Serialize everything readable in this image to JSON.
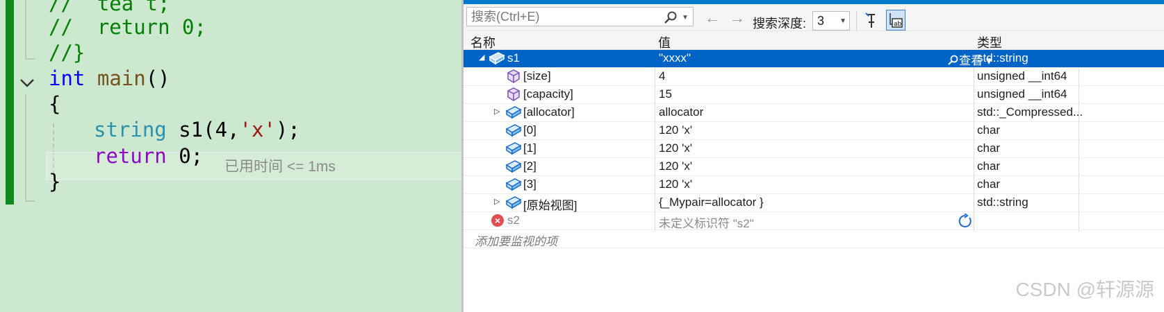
{
  "editor": {
    "lines": {
      "l0": "//  tea t;",
      "l1": "//  return 0;",
      "l2": "//}",
      "l3_kw": "int",
      "l3_fn": "main",
      "l3_rest": "()",
      "l4": "{",
      "l5_type": "string",
      "l5_name": " s1(4,",
      "l5_str": "'x'",
      "l5_rest": ");",
      "l6_ctl": "return",
      "l6_rest": " 0;",
      "l7": "}"
    },
    "perf_tip": "已用时间 <= 1ms"
  },
  "toolbar": {
    "search_placeholder": "搜索(Ctrl+E)",
    "depth_label": "搜索深度:",
    "depth_value": "3"
  },
  "grid": {
    "headers": {
      "name": "名称",
      "value": "值",
      "type": "类型"
    },
    "rows": [
      {
        "name": "s1",
        "value": "\"xxxx\"",
        "type": "std::string",
        "view_label": "查看"
      },
      {
        "name": "[size]",
        "value": "4",
        "type": "unsigned __int64"
      },
      {
        "name": "[capacity]",
        "value": "15",
        "type": "unsigned __int64"
      },
      {
        "name": "[allocator]",
        "value": "allocator",
        "type": "std::_Compressed..."
      },
      {
        "name": "[0]",
        "value": "120 'x'",
        "type": "char"
      },
      {
        "name": "[1]",
        "value": "120 'x'",
        "type": "char"
      },
      {
        "name": "[2]",
        "value": "120 'x'",
        "type": "char"
      },
      {
        "name": "[3]",
        "value": "120 'x'",
        "type": "char"
      },
      {
        "name": "[原始视图]",
        "value": "{_Mypair=allocator }",
        "type": "std::string"
      },
      {
        "name": "s2",
        "value": "未定义标识符 \"s2\"",
        "type": ""
      }
    ],
    "add_watch_text": "添加要监视的项"
  },
  "watermark": "CSDN @轩源源",
  "colors": {
    "selection": "#0063c6",
    "accent": "#007acc",
    "editor_bg": "#cce8cf",
    "change_bar": "#108a1c"
  }
}
